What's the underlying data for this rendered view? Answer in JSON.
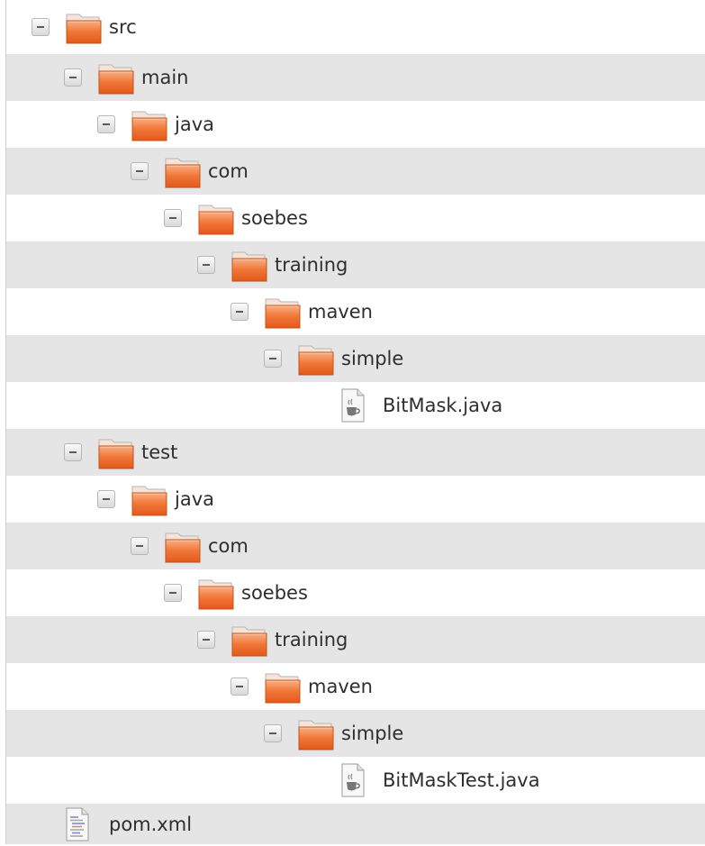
{
  "tree": {
    "rows": [
      {
        "label": "src",
        "type": "folder",
        "expanded": true
      },
      {
        "label": "main",
        "type": "folder",
        "expanded": true
      },
      {
        "label": "java",
        "type": "folder",
        "expanded": true
      },
      {
        "label": "com",
        "type": "folder",
        "expanded": true
      },
      {
        "label": "soebes",
        "type": "folder",
        "expanded": true
      },
      {
        "label": "training",
        "type": "folder",
        "expanded": true
      },
      {
        "label": "maven",
        "type": "folder",
        "expanded": true
      },
      {
        "label": "simple",
        "type": "folder",
        "expanded": true
      },
      {
        "label": "BitMask.java",
        "type": "java-file"
      },
      {
        "label": "test",
        "type": "folder",
        "expanded": true
      },
      {
        "label": "java",
        "type": "folder",
        "expanded": true
      },
      {
        "label": "com",
        "type": "folder",
        "expanded": true
      },
      {
        "label": "soebes",
        "type": "folder",
        "expanded": true
      },
      {
        "label": "training",
        "type": "folder",
        "expanded": true
      },
      {
        "label": "maven",
        "type": "folder",
        "expanded": true
      },
      {
        "label": "simple",
        "type": "folder",
        "expanded": true
      },
      {
        "label": "BitMaskTest.java",
        "type": "java-file"
      },
      {
        "label": "pom.xml",
        "type": "xml-file"
      }
    ]
  },
  "icons": {
    "folder": "folder-icon",
    "java-file": "java-file-icon",
    "xml-file": "xml-file-icon",
    "toggle": "collapse-icon"
  },
  "colors": {
    "row_alt": "#e5e5e5",
    "folder_orange": "#e4571a",
    "folder_light": "#fbb08a"
  }
}
